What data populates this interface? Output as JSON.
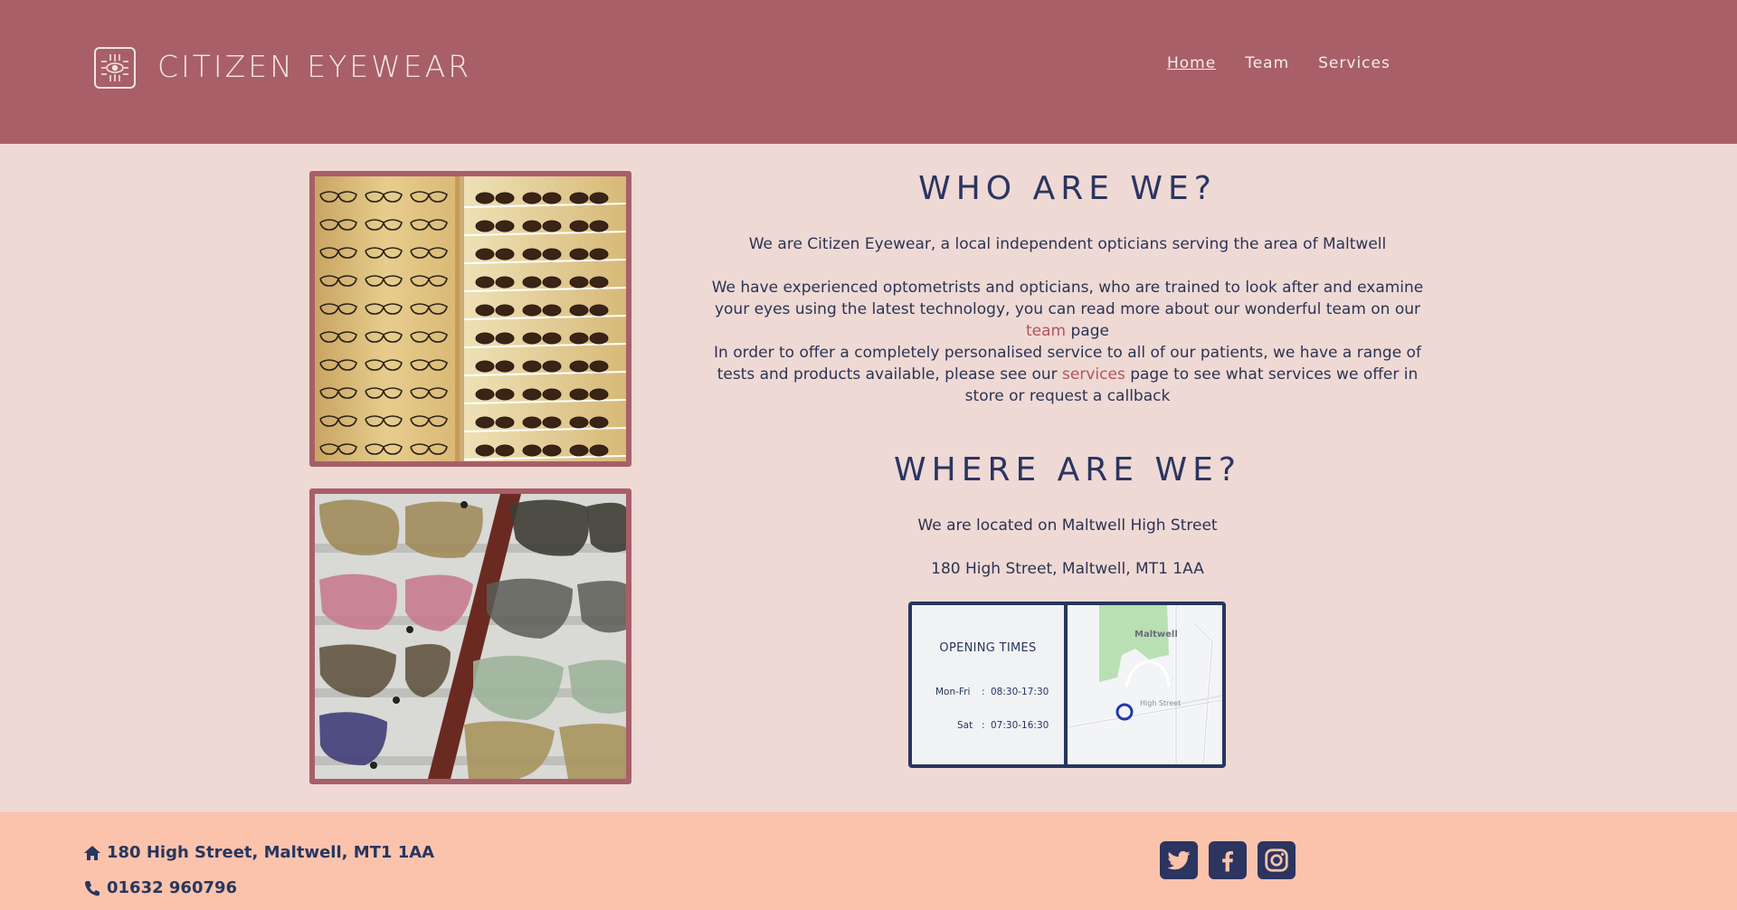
{
  "header": {
    "brand": "CITIZEN EYEWEAR",
    "nav": [
      {
        "label": "Home",
        "active": true
      },
      {
        "label": "Team",
        "active": false
      },
      {
        "label": "Services",
        "active": false
      }
    ]
  },
  "images": {
    "top_alt": "eye-glasses-display",
    "bottom_alt": "glasses-frames-closeup"
  },
  "who": {
    "heading": "WHO ARE WE?",
    "p1": "We are Citizen Eyewear, a local independent opticians serving the area of Maltwell",
    "p2_before": "We have experienced optometrists and opticians, who are trained to look after and examine your eyes using the latest technology, you can read more about our wonderful team on our ",
    "p2_link": "team",
    "p2_after": " page",
    "p3_before": "In order to offer a completely personalised service to all of our patients, we have a range of tests and products available, please see our ",
    "p3_link": "services",
    "p3_after": " page to see what services we offer in store or request a callback"
  },
  "where": {
    "heading": "WHERE ARE WE?",
    "p1": "We are located on Maltwell High Street",
    "address": "180 High Street, Maltwell, MT1 1AA"
  },
  "opening_card": {
    "title": "OPENING TIMES",
    "rows": [
      {
        "day": "Mon-Fri",
        "sep": ":",
        "hours": "08:30-17:30"
      },
      {
        "day": "Sat",
        "sep": ":",
        "hours": "07:30-16:30"
      }
    ],
    "map_town": "Maltwell",
    "map_street": "High Street"
  },
  "footer": {
    "address": "180 High Street, Maltwell, MT1 1AA",
    "phone": "01632 960796",
    "social_icons": [
      "twitter-icon",
      "facebook-icon",
      "instagram-icon"
    ]
  },
  "colors": {
    "header_bg": "#a85f68",
    "body_bg": "#efd9d5",
    "footer_bg": "#fcc3ac",
    "navy": "#2b3560",
    "link": "#b2545a"
  }
}
